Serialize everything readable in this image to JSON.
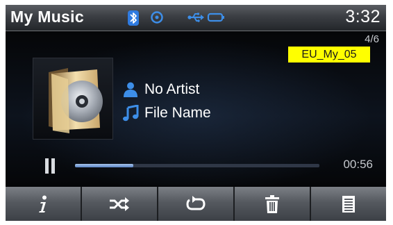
{
  "status_bar": {
    "title": "My Music",
    "clock": "3:32",
    "icons": [
      "bluetooth-icon",
      "disc-mode-icon",
      "usb-icon",
      "battery-icon"
    ]
  },
  "player": {
    "track_counter": "4/6",
    "code_label": "EU_My_05",
    "artist": "No Artist",
    "file_name": "File Name",
    "elapsed": "00:56",
    "progress_fraction": 0.24,
    "state": "playing"
  },
  "buttons": [
    {
      "name": "info-button",
      "icon": "info-icon"
    },
    {
      "name": "shuffle-button",
      "icon": "shuffle-icon"
    },
    {
      "name": "repeat-button",
      "icon": "repeat-icon"
    },
    {
      "name": "delete-button",
      "icon": "trash-icon"
    },
    {
      "name": "list-button",
      "icon": "list-icon"
    }
  ],
  "colors": {
    "accent_blue": "#3d8ee8",
    "label_yellow": "#ffff00",
    "screen_bg": "#040507"
  }
}
